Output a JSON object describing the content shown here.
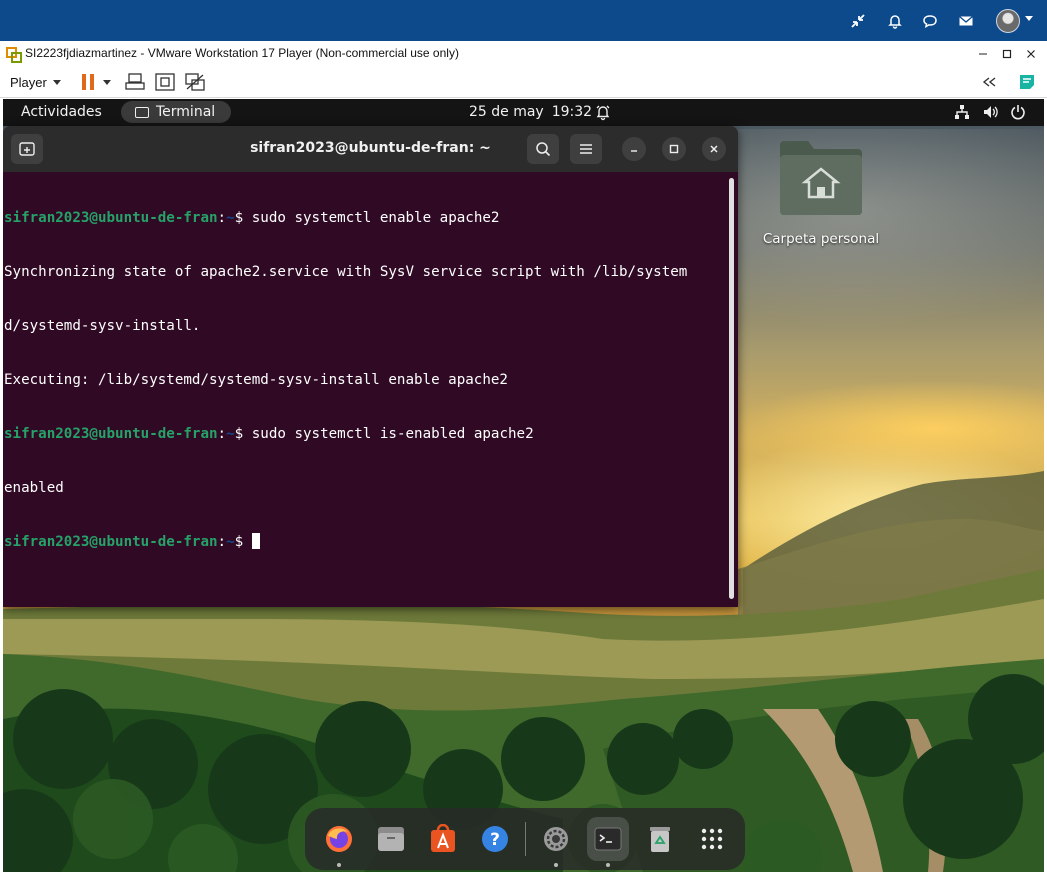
{
  "host_bar": {
    "icons": [
      "minimize-arrows-icon",
      "bell-icon",
      "chat-bubble-icon",
      "envelope-icon",
      "user-avatar"
    ]
  },
  "vmware": {
    "title": "SI2223fjdiazmartinez - VMware Workstation 17 Player (Non-commercial use only)",
    "player_menu": "Player",
    "toolbar_icons": [
      "pause-icon",
      "send-ctrl-alt-del-icon",
      "fit-guest-icon",
      "unity-mode-icon"
    ],
    "right_icons": [
      "collapse-toolbar-icon",
      "notes-icon"
    ]
  },
  "gnome": {
    "activities": "Actividades",
    "app_pill": "Terminal",
    "date": "25 de may",
    "time": "19:32"
  },
  "terminal": {
    "title": "sifran2023@ubuntu-de-fran: ~",
    "lines": [
      {
        "user": "sifran2023@ubuntu-de-fran",
        "sep": ":",
        "path": "~",
        "prompt_end": "$ ",
        "cmd": "sudo systemctl enable apache2"
      },
      {
        "text": "Synchronizing state of apache2.service with SysV service script with /lib/system"
      },
      {
        "text": "d/systemd-sysv-install."
      },
      {
        "text": "Executing: /lib/systemd/systemd-sysv-install enable apache2"
      },
      {
        "user": "sifran2023@ubuntu-de-fran",
        "sep": ":",
        "path": "~",
        "prompt_end": "$ ",
        "cmd": "sudo systemctl is-enabled apache2"
      },
      {
        "text": "enabled"
      },
      {
        "user": "sifran2023@ubuntu-de-fran",
        "sep": ":",
        "path": "~",
        "prompt_end": "$ ",
        "cmd": ""
      }
    ]
  },
  "desktop": {
    "folder_label": "Carpeta personal"
  },
  "dock": {
    "items": [
      "firefox-icon",
      "files-icon",
      "app-center-icon",
      "help-icon",
      "settings-icon",
      "terminal-icon",
      "trash-icon",
      "show-apps-icon"
    ]
  },
  "colors": {
    "host_bar": "#0d4a8c",
    "terminal_bg": "#300a24",
    "prompt_user": "#26a269",
    "prompt_path": "#12488b"
  }
}
